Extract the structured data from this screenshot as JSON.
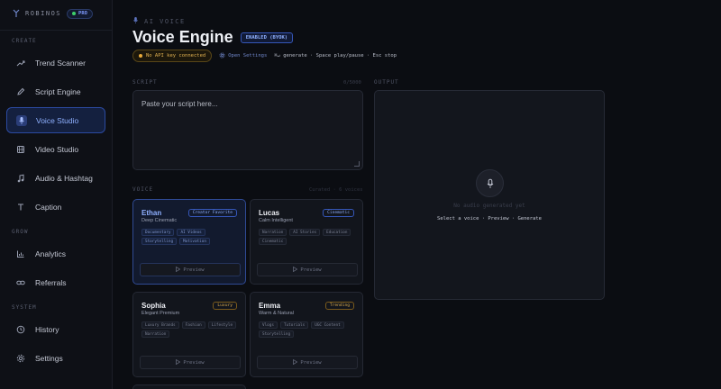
{
  "brand": {
    "name": "ROBINOS",
    "plan": "PRO"
  },
  "sidebar": {
    "sections": [
      {
        "label": "CREATE"
      },
      {
        "label": "GROW"
      },
      {
        "label": "SYSTEM"
      }
    ],
    "items": [
      {
        "label": "Trend Scanner",
        "icon": "trend-icon"
      },
      {
        "label": "Script Engine",
        "icon": "pen-icon"
      },
      {
        "label": "Voice Studio",
        "icon": "mic-icon",
        "active": true
      },
      {
        "label": "Video Studio",
        "icon": "film-icon"
      },
      {
        "label": "Audio & Hashtag",
        "icon": "music-icon"
      },
      {
        "label": "Caption",
        "icon": "text-icon"
      },
      {
        "label": "Analytics",
        "icon": "chart-icon"
      },
      {
        "label": "Referrals",
        "icon": "link-icon"
      },
      {
        "label": "History",
        "icon": "clock-icon"
      },
      {
        "label": "Settings",
        "icon": "gear-icon"
      }
    ]
  },
  "header": {
    "eyebrow": "AI VOICE",
    "title": "Voice Engine",
    "badge": "ENABLED (BYOK)",
    "api_status": "No API key connected",
    "open_settings": "Open Settings",
    "shortcuts": "⌘↵ generate · Space play/pause · Esc stop"
  },
  "script": {
    "label": "SCRIPT",
    "char_count": "0/5000",
    "placeholder": "Paste your script here..."
  },
  "voices": {
    "label": "VOICE",
    "filter": "Curated · 6 voices",
    "preview_label": "Preview",
    "cards": [
      {
        "name": "Ethan",
        "desc": "Deep Cinematic",
        "badge": "Creator Favorite",
        "tags": [
          "Documentary",
          "AI Videos",
          "Storytelling",
          "Motivation"
        ],
        "selected": true
      },
      {
        "name": "Lucas",
        "desc": "Calm Intelligent",
        "badge": "Cinematic",
        "tags": [
          "Narration",
          "AI Stories",
          "Education",
          "Cinematic"
        ]
      },
      {
        "name": "Sophia",
        "desc": "Elegant Premium",
        "badge": "Luxury",
        "tags": [
          "Luxury Brands",
          "Fashion",
          "Lifestyle",
          "Narration"
        ]
      },
      {
        "name": "Emma",
        "desc": "Warm & Natural",
        "badge": "Trending",
        "tags": [
          "Vlogs",
          "Tutorials",
          "UGC Content",
          "Storytelling"
        ]
      }
    ]
  },
  "output": {
    "label": "OUTPUT",
    "empty": "No audio generated yet",
    "hint": "Select a voice · Preview · Generate"
  },
  "colors": {
    "accent": "#8fb0ff",
    "warning": "#e0b050",
    "background": "#0b0d12"
  }
}
